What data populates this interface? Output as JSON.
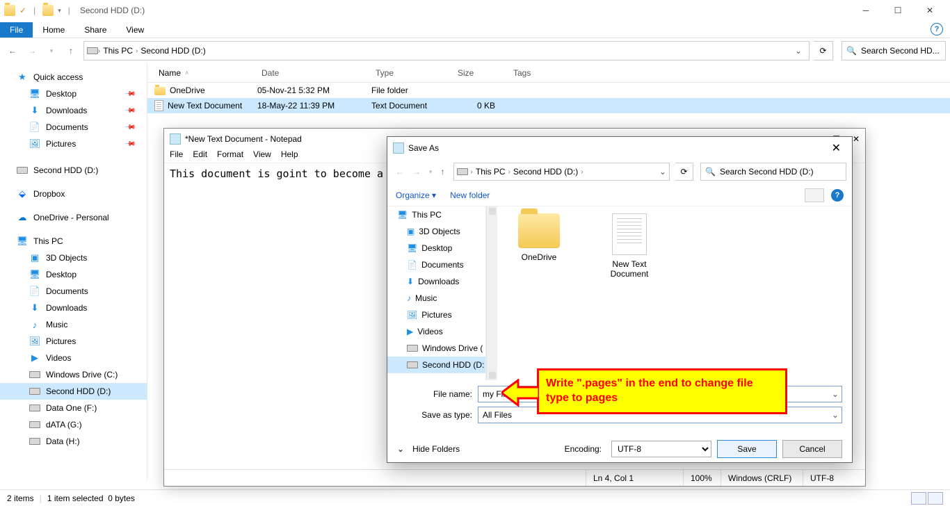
{
  "explorer": {
    "title": "Second HDD (D:)",
    "tabs": {
      "file": "File",
      "home": "Home",
      "share": "Share",
      "view": "View"
    },
    "breadcrumb": [
      "This PC",
      "Second HDD (D:)"
    ],
    "search_placeholder": "Search Second HD...",
    "columns": {
      "name": "Name",
      "date": "Date",
      "type": "Type",
      "size": "Size",
      "tags": "Tags"
    },
    "rows": [
      {
        "name": "OneDrive",
        "date": "05-Nov-21 5:32 PM",
        "type": "File folder",
        "size": "",
        "icon": "folder"
      },
      {
        "name": "New Text Document",
        "date": "18-May-22 11:39 PM",
        "type": "Text Document",
        "size": "0 KB",
        "icon": "doc",
        "selected": true
      }
    ],
    "nav": {
      "quick": "Quick access",
      "quick_items": [
        "Desktop",
        "Downloads",
        "Documents",
        "Pictures"
      ],
      "second": "Second HDD (D:)",
      "dropbox": "Dropbox",
      "onedrive": "OneDrive - Personal",
      "thispc": "This PC",
      "pc_items": [
        "3D Objects",
        "Desktop",
        "Documents",
        "Downloads",
        "Music",
        "Pictures",
        "Videos",
        "Windows Drive (C:)",
        "Second HDD (D:)",
        "Data One (F:)",
        "dATA (G:)",
        "Data (H:)"
      ]
    },
    "status": {
      "items": "2 items",
      "sel": "1 item selected",
      "bytes": "0 bytes"
    }
  },
  "notepad": {
    "title": "*New Text Document - Notepad",
    "menu": [
      "File",
      "Edit",
      "Format",
      "View",
      "Help"
    ],
    "body": "This document is goint to become a Pages",
    "status": {
      "pos": "Ln 4, Col 1",
      "zoom": "100%",
      "eol": "Windows (CRLF)",
      "enc": "UTF-8"
    }
  },
  "saveas": {
    "title": "Save As",
    "breadcrumb": [
      "This PC",
      "Second HDD (D:)"
    ],
    "search_placeholder": "Search Second HDD (D:)",
    "organize": "Organize",
    "newfolder": "New folder",
    "tree": [
      {
        "label": "This PC",
        "indent": false,
        "icon": "pc"
      },
      {
        "label": "3D Objects",
        "indent": true,
        "icon": "3d"
      },
      {
        "label": "Desktop",
        "indent": true,
        "icon": "desk"
      },
      {
        "label": "Documents",
        "indent": true,
        "icon": "doc"
      },
      {
        "label": "Downloads",
        "indent": true,
        "icon": "dl"
      },
      {
        "label": "Music",
        "indent": true,
        "icon": "music"
      },
      {
        "label": "Pictures",
        "indent": true,
        "icon": "pic"
      },
      {
        "label": "Videos",
        "indent": true,
        "icon": "vid"
      },
      {
        "label": "Windows Drive (",
        "indent": true,
        "icon": "drive"
      },
      {
        "label": "Second HDD (D:",
        "indent": true,
        "icon": "drive",
        "selected": true
      }
    ],
    "files": [
      {
        "name": "OneDrive",
        "icon": "folder"
      },
      {
        "name": "New Text Document",
        "icon": "doc"
      }
    ],
    "filename_label": "File name:",
    "filename": "my File.pages",
    "saveastype_label": "Save as type:",
    "saveastype": "All Files",
    "hide": "Hide Folders",
    "encoding_label": "Encoding:",
    "encoding": "UTF-8",
    "save": "Save",
    "cancel": "Cancel"
  },
  "callout": "Write \".pages\" in the end to change file type to pages"
}
